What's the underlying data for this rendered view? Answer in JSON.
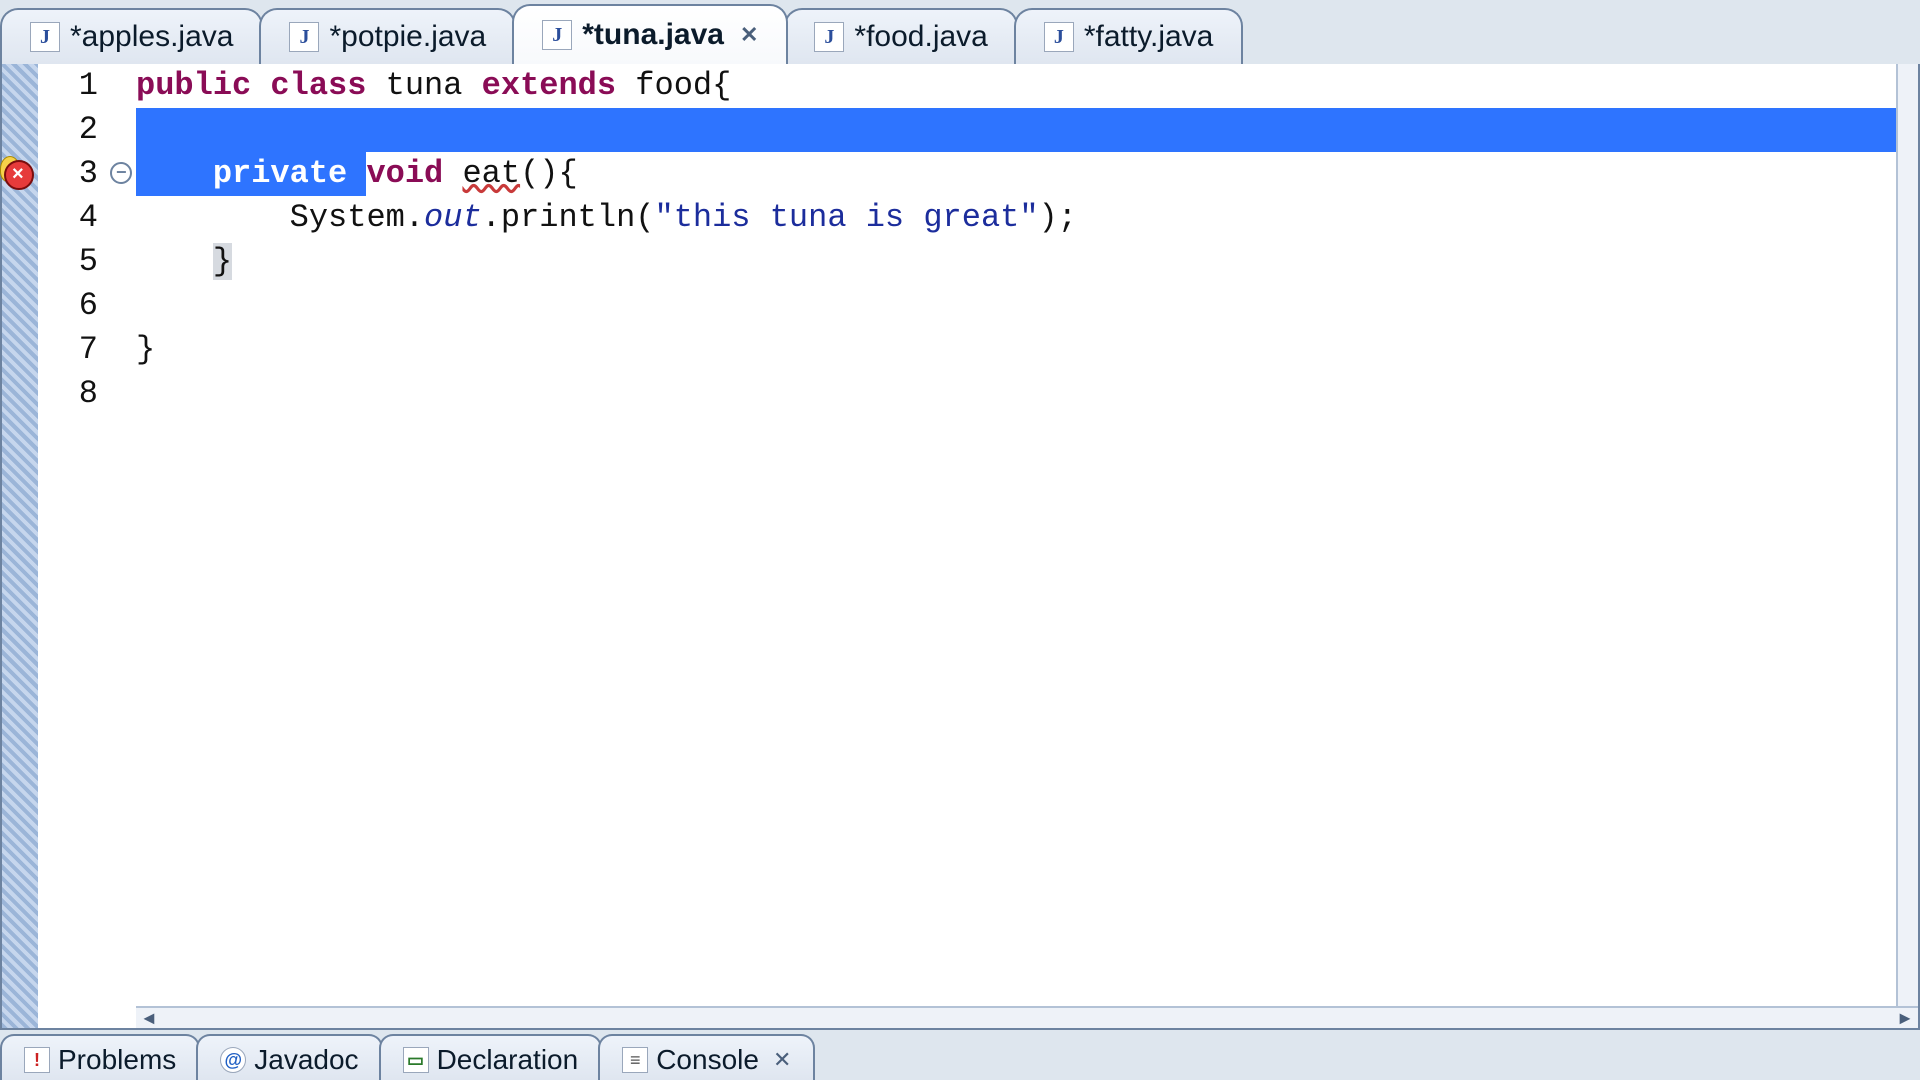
{
  "tabs": [
    {
      "label": "*apples.java",
      "active": false
    },
    {
      "label": "*potpie.java",
      "active": false
    },
    {
      "label": "*tuna.java",
      "active": true
    },
    {
      "label": "*food.java",
      "active": false
    },
    {
      "label": "*fatty.java",
      "active": false
    }
  ],
  "lines": {
    "count": 8,
    "l1": {
      "pre": "",
      "kw1": "public",
      "s1": " ",
      "kw2": "class",
      "s2": " ",
      "id1": "tuna",
      "s3": " ",
      "kw3": "extends",
      "s4": " ",
      "id2": "food",
      "post": "{"
    },
    "l3": {
      "indent": "    ",
      "kw1": "private",
      "s1": " ",
      "kw2": "void",
      "s2": " ",
      "method": "eat",
      "post": "(){",
      "selected_upto": "private "
    },
    "l4": {
      "indent": "        ",
      "obj": "System.",
      "fld": "out",
      "rest1": ".println(",
      "str": "\"this tuna is great\"",
      "rest2": ");"
    },
    "l5": {
      "indent": "    ",
      "brace": "}"
    },
    "l7": {
      "brace": "}"
    }
  },
  "markers": {
    "error_line": 3,
    "fold_line": 3
  },
  "views": [
    {
      "label": "Problems",
      "icon": "problems"
    },
    {
      "label": "Javadoc",
      "icon": "javadoc"
    },
    {
      "label": "Declaration",
      "icon": "decl"
    },
    {
      "label": "Console",
      "icon": "console"
    }
  ],
  "scroll": {
    "left": "◄",
    "right": "►"
  },
  "icons": {
    "close": "✕",
    "at": "@",
    "j": "J",
    "excl": "!",
    "lines": "≡",
    "gt": "▭"
  }
}
